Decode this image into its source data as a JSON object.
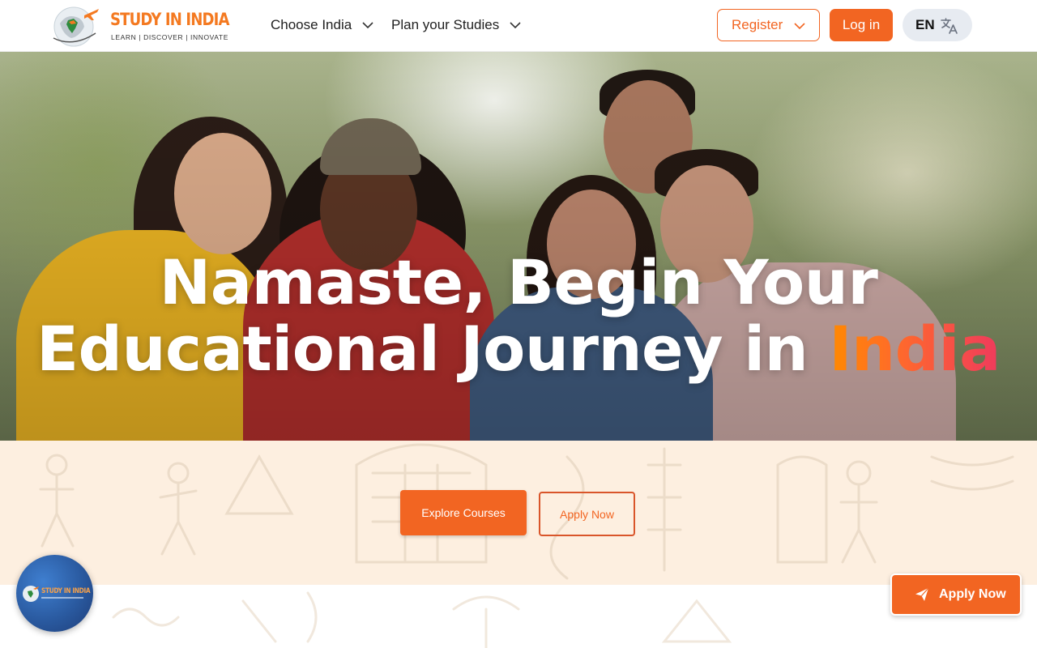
{
  "brand": {
    "name": "STUDY IN INDIA",
    "tagline": "LEARN | DISCOVER | INNOVATE",
    "primary_color": "#f26522",
    "logo_icon": "globe-with-airplane-icon"
  },
  "header": {
    "nav": [
      {
        "label": "Choose India",
        "icon": "chevron-down-icon"
      },
      {
        "label": "Plan your Studies",
        "icon": "chevron-down-icon"
      }
    ],
    "register_label": "Register",
    "login_label": "Log in",
    "language_code": "EN",
    "language_icon": "translate-icon"
  },
  "hero": {
    "title_line1": "Namaste, Begin Your",
    "title_line2_prefix": "Educational Journey in ",
    "title_line2_highlight": "India",
    "highlight_colors": [
      "#ff8a00",
      "#ef3a5d"
    ],
    "image": "group-of-smiling-students-photo"
  },
  "cta": {
    "explore_label": "Explore Courses",
    "apply_label": "Apply Now",
    "background_color": "#fdefe0"
  },
  "floating": {
    "chat_badge_text": "STUDY IN INDIA",
    "apply_label": "Apply Now",
    "apply_icon": "send-icon"
  }
}
